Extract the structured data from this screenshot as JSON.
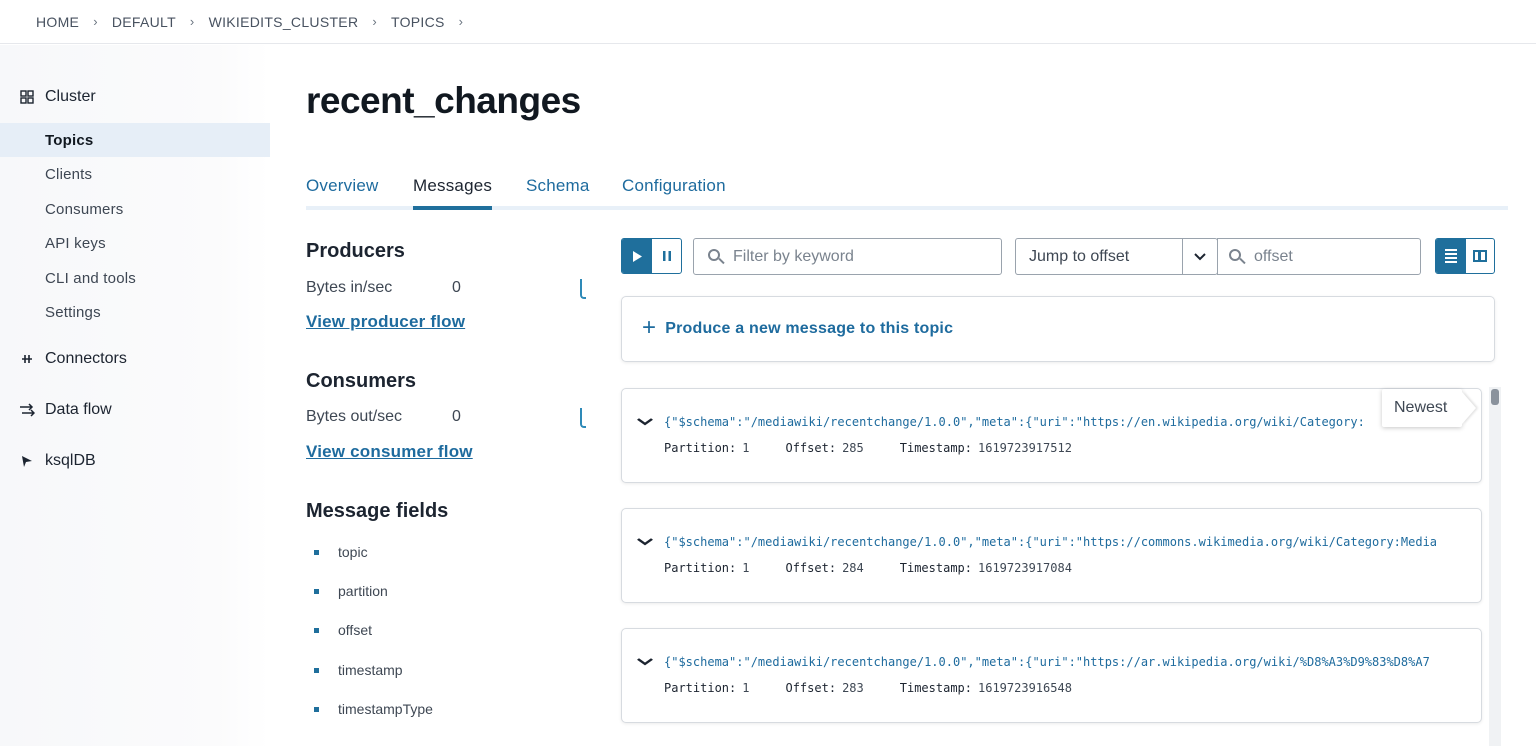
{
  "breadcrumb": {
    "items": [
      "HOME",
      "DEFAULT",
      "WIKIEDITS_CLUSTER",
      "TOPICS"
    ],
    "separator": "›"
  },
  "sidebar": {
    "cluster_label": "Cluster",
    "items": [
      {
        "label": "Topics",
        "active": true
      },
      {
        "label": "Clients"
      },
      {
        "label": "Consumers"
      },
      {
        "label": "API keys"
      },
      {
        "label": "CLI and tools"
      },
      {
        "label": "Settings"
      }
    ],
    "connectors_label": "Connectors",
    "dataflow_label": "Data flow",
    "ksqldb_label": "ksqlDB"
  },
  "page": {
    "title": "recent_changes",
    "tabs": [
      "Overview",
      "Messages",
      "Schema",
      "Configuration"
    ],
    "active_tab": "Messages"
  },
  "producers": {
    "heading": "Producers",
    "stat_label": "Bytes in/sec",
    "stat_value": "0",
    "link": "View producer flow"
  },
  "consumers": {
    "heading": "Consumers",
    "stat_label": "Bytes out/sec",
    "stat_value": "0",
    "link": "View consumer flow"
  },
  "message_fields": {
    "heading": "Message fields",
    "fields": [
      "topic",
      "partition",
      "offset",
      "timestamp",
      "timestampType"
    ]
  },
  "toolbar": {
    "filter_placeholder": "Filter by keyword",
    "jump_label": "Jump to offset",
    "offset_placeholder": "offset"
  },
  "produce": {
    "label": "Produce a new message to this topic"
  },
  "messages": [
    {
      "body": "{\"$schema\":\"/mediawiki/recentchange/1.0.0\",\"meta\":{\"uri\":\"https://en.wikipedia.org/wiki/Category:",
      "partition_label": "Partition:",
      "partition": "1",
      "offset_label": "Offset:",
      "offset": "285",
      "timestamp_label": "Timestamp:",
      "timestamp": "1619723917512"
    },
    {
      "body": "{\"$schema\":\"/mediawiki/recentchange/1.0.0\",\"meta\":{\"uri\":\"https://commons.wikimedia.org/wiki/Category:Media",
      "partition_label": "Partition:",
      "partition": "1",
      "offset_label": "Offset:",
      "offset": "284",
      "timestamp_label": "Timestamp:",
      "timestamp": "1619723917084"
    },
    {
      "body": "{\"$schema\":\"/mediawiki/recentchange/1.0.0\",\"meta\":{\"uri\":\"https://ar.wikipedia.org/wiki/%D8%A3%D9%83%D8%A7",
      "partition_label": "Partition:",
      "partition": "1",
      "offset_label": "Offset:",
      "offset": "283",
      "timestamp_label": "Timestamp:",
      "timestamp": "1619723916548"
    }
  ],
  "newest_tooltip": "Newest",
  "colors": {
    "accent": "#1f6f9c",
    "link": "#1e6b9e",
    "text": "#1c2430",
    "sidebar_active_bg": "#e6eef7"
  }
}
